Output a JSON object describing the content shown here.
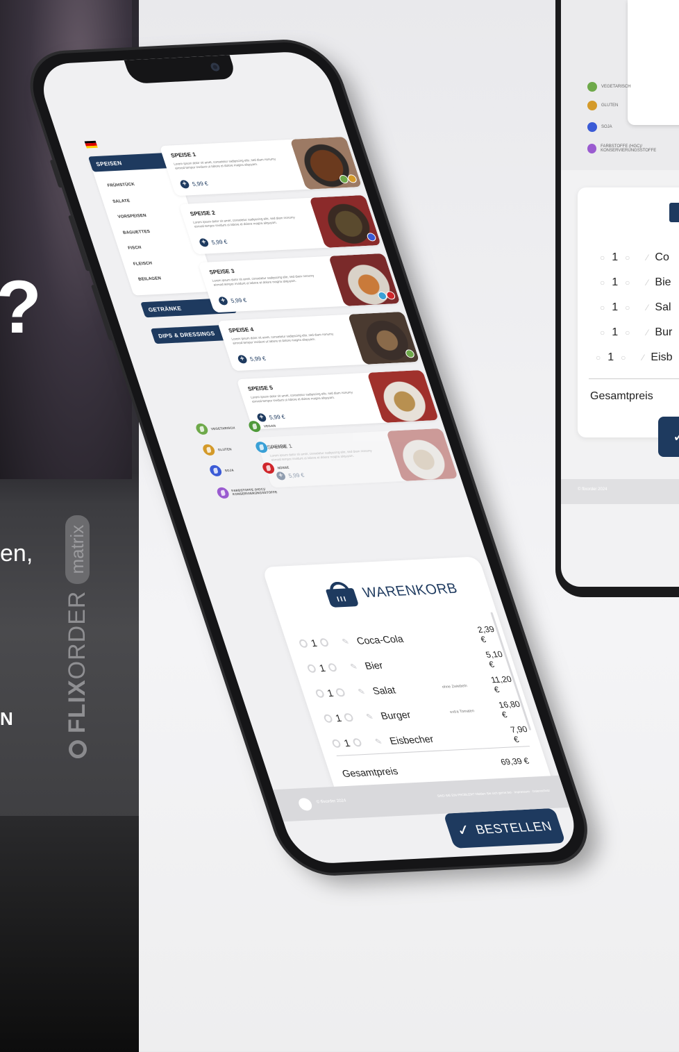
{
  "side": {
    "fragment_q": "?",
    "fragment_en": "en,",
    "fragment_n": "N",
    "brand_flix": "FLIX",
    "brand_order": "ORDER",
    "brand_pill": "matrix"
  },
  "colors": {
    "primary": "#1e3a5f",
    "vegetarian": "#6ea94a",
    "vegan": "#4f9a3a",
    "gluten": "#d49a2a",
    "lactose": "#3aa0d6",
    "soy": "#3b5bd6",
    "nuts": "#d0262b",
    "additives": "#9a5bd0"
  },
  "menu": {
    "categories": [
      {
        "label": "SPEISEN",
        "chevron": "▲"
      },
      {
        "label": "GETRÄNKE",
        "chevron": "▼"
      },
      {
        "label": "DIPS & DRESSINGS",
        "chevron": "▼"
      }
    ],
    "subcategories": [
      "FRÜHSTÜCK",
      "SALATE",
      "VORSPEISEN",
      "BAGUETTES",
      "FISCH",
      "FLEISCH",
      "BEILAGEN"
    ]
  },
  "dishes": [
    {
      "title": "SPEISE 1",
      "desc": "Lorem ipsum dolor sit amet, consetetur sadipscing elitr, sed diam nonumy eirmod tempor invidunt ut labore et dolore magna aliquyam.",
      "price": "5,99 €"
    },
    {
      "title": "SPEISE 2",
      "desc": "Lorem ipsum dolor sit amet, consetetur sadipscing elitr, sed diam nonumy eirmod tempor invidunt ut labore et dolore magna aliquyam.",
      "price": "5,99 €"
    },
    {
      "title": "SPEISE 3",
      "desc": "Lorem ipsum dolor sit amet, consetetur sadipscing elitr, sed diam nonumy eirmod tempor invidunt ut labore et dolore magna aliquyam.",
      "price": "5,99 €"
    },
    {
      "title": "SPEISE 4",
      "desc": "Lorem ipsum dolor sit amet, consetetur sadipscing elitr, sed diam nonumy eirmod tempor invidunt ut labore et dolore magna aliquyam.",
      "price": "5,99 €"
    },
    {
      "title": "SPEISE 5",
      "desc": "Lorem ipsum dolor sit amet, consetetur sadipscing elitr, sed diam nonumy eirmod tempor invidunt ut labore et dolore magna aliquyam.",
      "price": "5,99 €"
    },
    {
      "title": "SPEISE 1",
      "desc": "Lorem ipsum dolor sit amet, consetetur sadipscing elitr, sed diam nonumy eirmod tempor invidunt ut labore et dolore magna aliquyam.",
      "price": "5,99 €"
    }
  ],
  "legend": [
    {
      "label": "VEGETARISCH",
      "icon": "leaf-icon"
    },
    {
      "label": "VEGAN",
      "icon": "leaf-icon"
    },
    {
      "label": "GLUTEN",
      "icon": "wheat-icon"
    },
    {
      "label": "LAKTOSE",
      "icon": "milk-icon"
    },
    {
      "label": "SOJA",
      "icon": "soy-icon"
    },
    {
      "label": "NÜSSE",
      "icon": "nut-icon"
    },
    {
      "label": "FARBSTOFFE (HGC)/ KONSERVIERUNGSSTOFFE",
      "icon": "additives-icon"
    }
  ],
  "cart": {
    "title": "WARENKORB",
    "items": [
      {
        "qty": "1",
        "name": "Coca-Cola",
        "note": "",
        "price": "2,39 €"
      },
      {
        "qty": "1",
        "name": "Bier",
        "note": "",
        "price": "5,10 €"
      },
      {
        "qty": "1",
        "name": "Salat",
        "note": "ohne Zwiebeln",
        "price": "11,20 €"
      },
      {
        "qty": "1",
        "name": "Burger",
        "note": "extra Tomaten",
        "price": "16,80 €"
      },
      {
        "qty": "1",
        "name": "Eisbecher",
        "note": "",
        "price": "7,90 €"
      }
    ],
    "total_label": "Gesamtpreis",
    "total_value": "69,39 €",
    "order_label": "BESTELLEN"
  },
  "footer": {
    "copyright": "© flixorder 2024",
    "links": "SIND SIE EIN PROBLEM? Melden Sie sich gerne bei · Impressum · Datenschutz"
  },
  "device2": {
    "items": [
      {
        "qty": "1",
        "name": "Co"
      },
      {
        "qty": "1",
        "name": "Bie"
      },
      {
        "qty": "1",
        "name": "Sal"
      },
      {
        "qty": "1",
        "name": "Bur"
      },
      {
        "qty": "1",
        "name": "Eisb"
      }
    ],
    "total_label": "Gesamtpreis",
    "legend": [
      "VEGETARISCH",
      "GLUTEN",
      "SOJA",
      "FARBSTOFFE (HGC)/ KONSERVIERUNGSSTOFFE"
    ],
    "footer": "© flixorder 2024"
  }
}
